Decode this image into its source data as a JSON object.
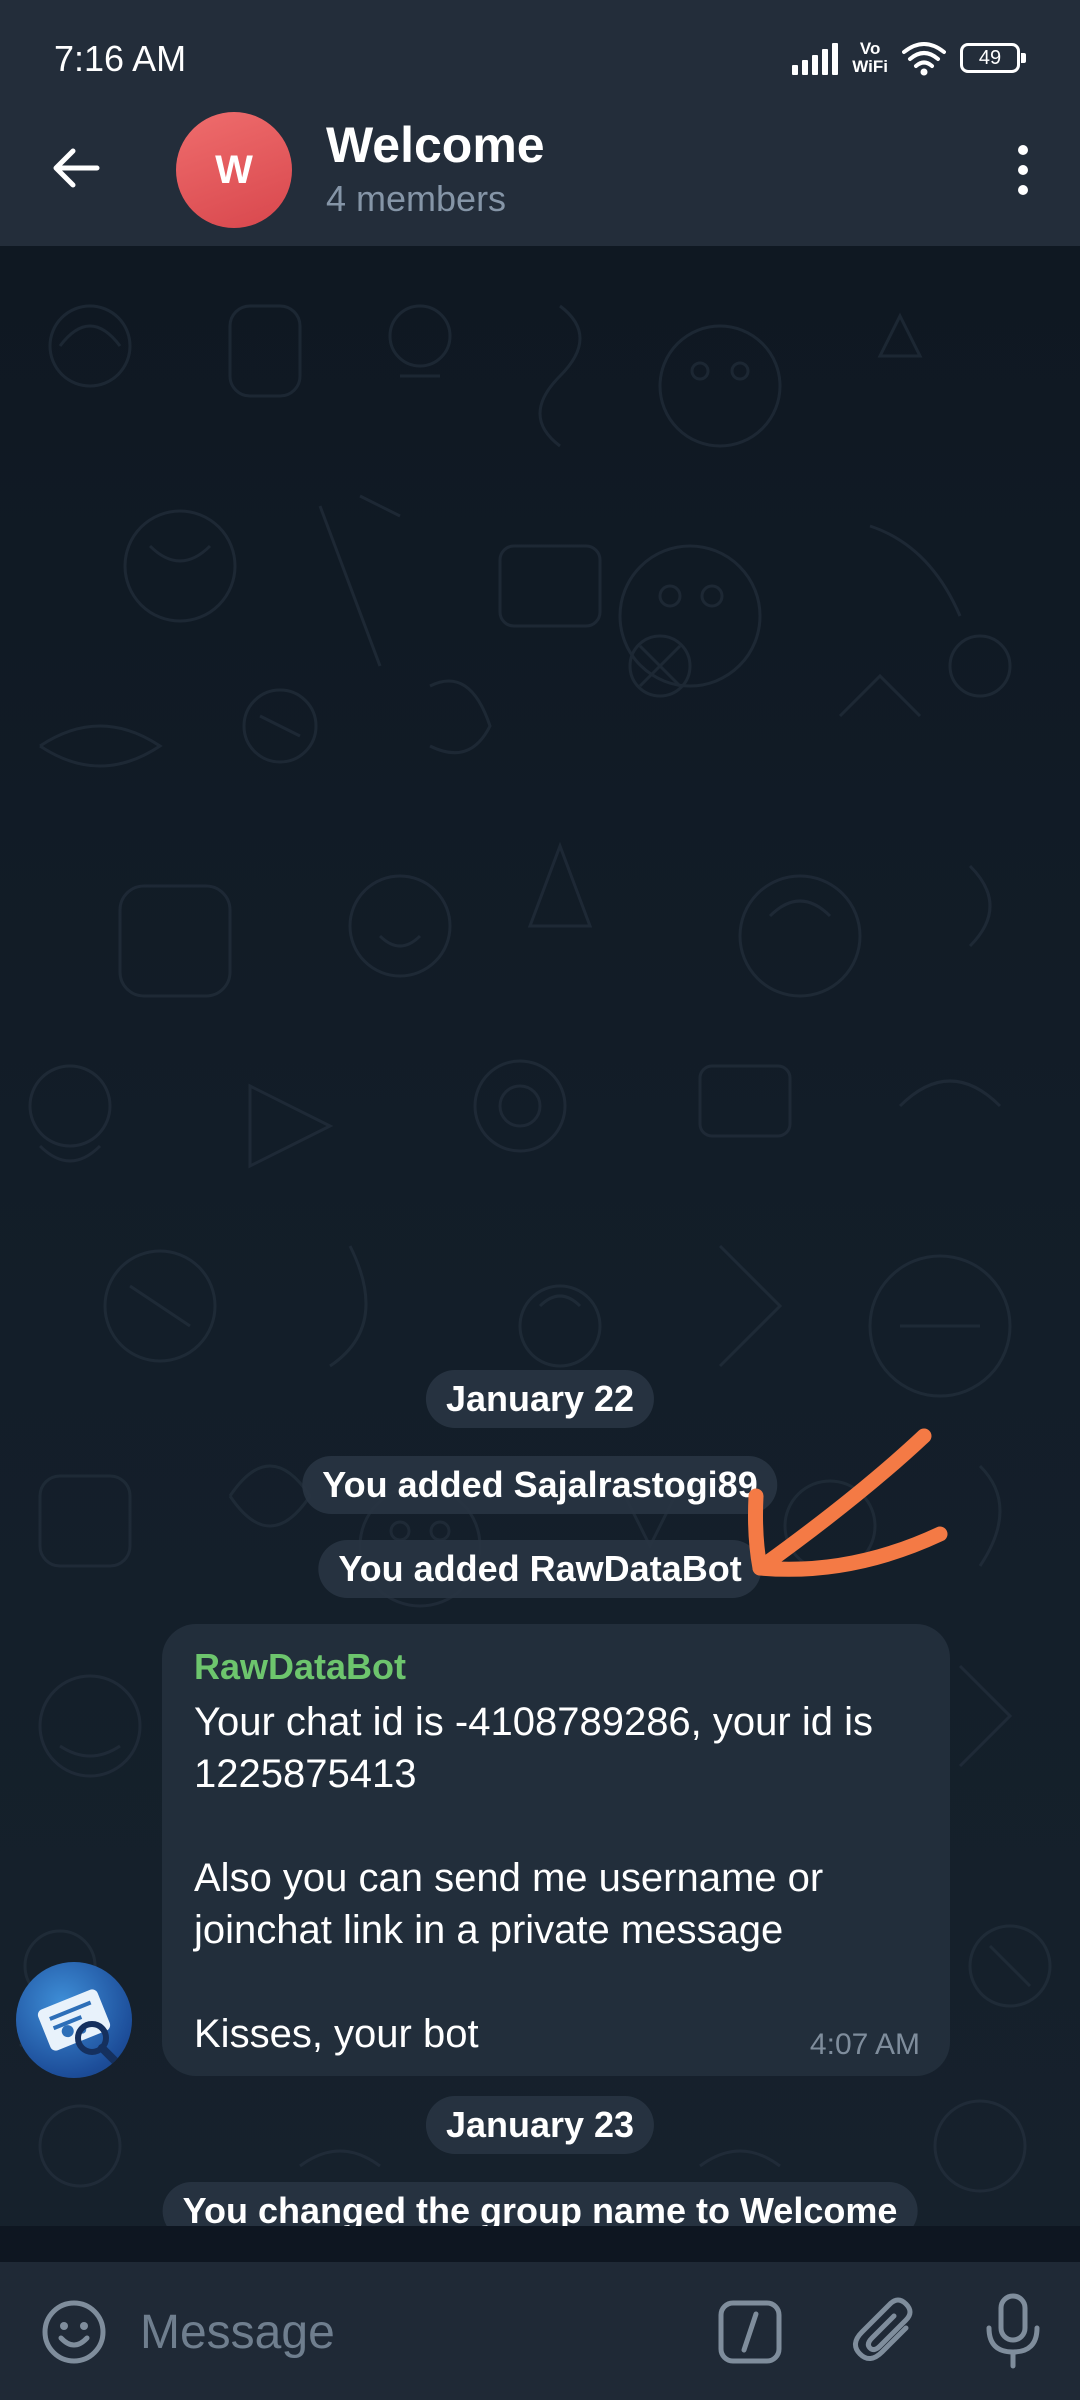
{
  "status_bar": {
    "time": "7:16 AM",
    "network_label_line1": "Vo",
    "network_label_line2": "WiFi",
    "battery": "49"
  },
  "header": {
    "avatar_letter": "W",
    "title": "Welcome",
    "subtitle": "4 members"
  },
  "chat": {
    "events": [
      {
        "type": "date",
        "text": "January 22"
      },
      {
        "type": "service",
        "text": "You added Sajalrastogi89"
      },
      {
        "type": "service",
        "text": "You added RawDataBot"
      },
      {
        "type": "date",
        "text": "January 23"
      },
      {
        "type": "service",
        "text": "You changed the group name to Welcome"
      }
    ],
    "message": {
      "sender": "RawDataBot",
      "paragraphs": [
        "Your chat id is -4108789286, your id is 1225875413",
        "Also you can send me username or joinchat link in a private message",
        "Kisses, your bot"
      ],
      "time": "4:07 AM"
    }
  },
  "input_bar": {
    "placeholder": "Message"
  },
  "colors": {
    "header_bg": "#232d3a",
    "chat_bg": "#0e1621",
    "bubble_bg": "#222e3b",
    "sender_name": "#6dc56d",
    "annotation_arrow": "#f47a45",
    "avatar_red": "#e0565a"
  },
  "icons": {
    "back": "arrow-left-icon",
    "menu": "more-vertical-icon",
    "emoji": "smile-icon",
    "commands": "slash-command-icon",
    "attach": "paperclip-icon",
    "mic": "microphone-icon"
  }
}
